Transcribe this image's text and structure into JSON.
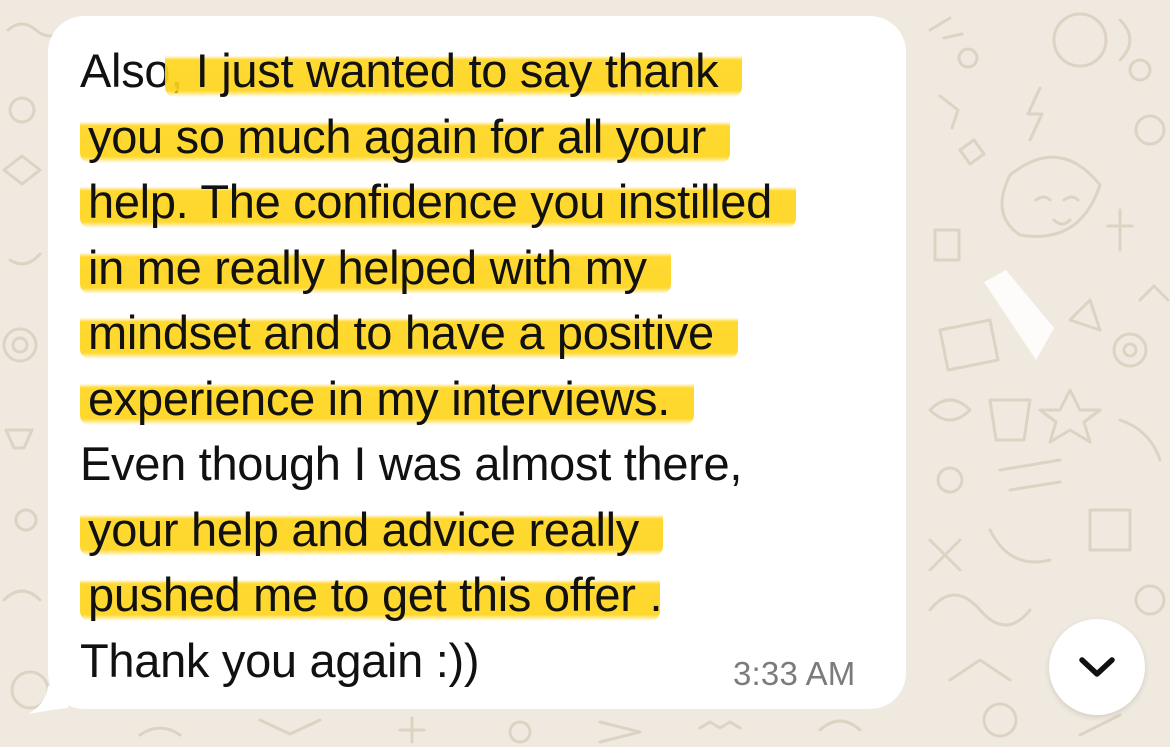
{
  "message": {
    "lines": [
      {
        "pre": "Also,",
        "hl": " I just wanted to say thank",
        "post": ""
      },
      {
        "pre": "",
        "hl": "you so much again for all your",
        "post": ""
      },
      {
        "pre": "",
        "hl": "help. The confidence you instilled",
        "post": ""
      },
      {
        "pre": "",
        "hl": "in me really helped with my",
        "post": ""
      },
      {
        "pre": "",
        "hl": "mindset and to have a positive",
        "post": ""
      },
      {
        "pre": "",
        "hl": "experience in my interviews.",
        "post": ""
      },
      {
        "pre": "Even though I was almost there,",
        "hl": "",
        "post": ""
      },
      {
        "pre": "",
        "hl": "your help and advice really",
        "post": ""
      },
      {
        "pre": "",
        "hl": "pushed me to get this offer",
        "post": "."
      },
      {
        "pre": "Thank you again :))",
        "hl": "",
        "post": ""
      }
    ],
    "timestamp": "3:33 AM"
  },
  "scroll_button": {
    "icon": "chevron-down-icon"
  },
  "colors": {
    "wallpaper": "#efe9df",
    "bubble": "#ffffff",
    "highlight": "#ffd41e",
    "text": "#111111",
    "timestamp": "#7b7b7b"
  }
}
